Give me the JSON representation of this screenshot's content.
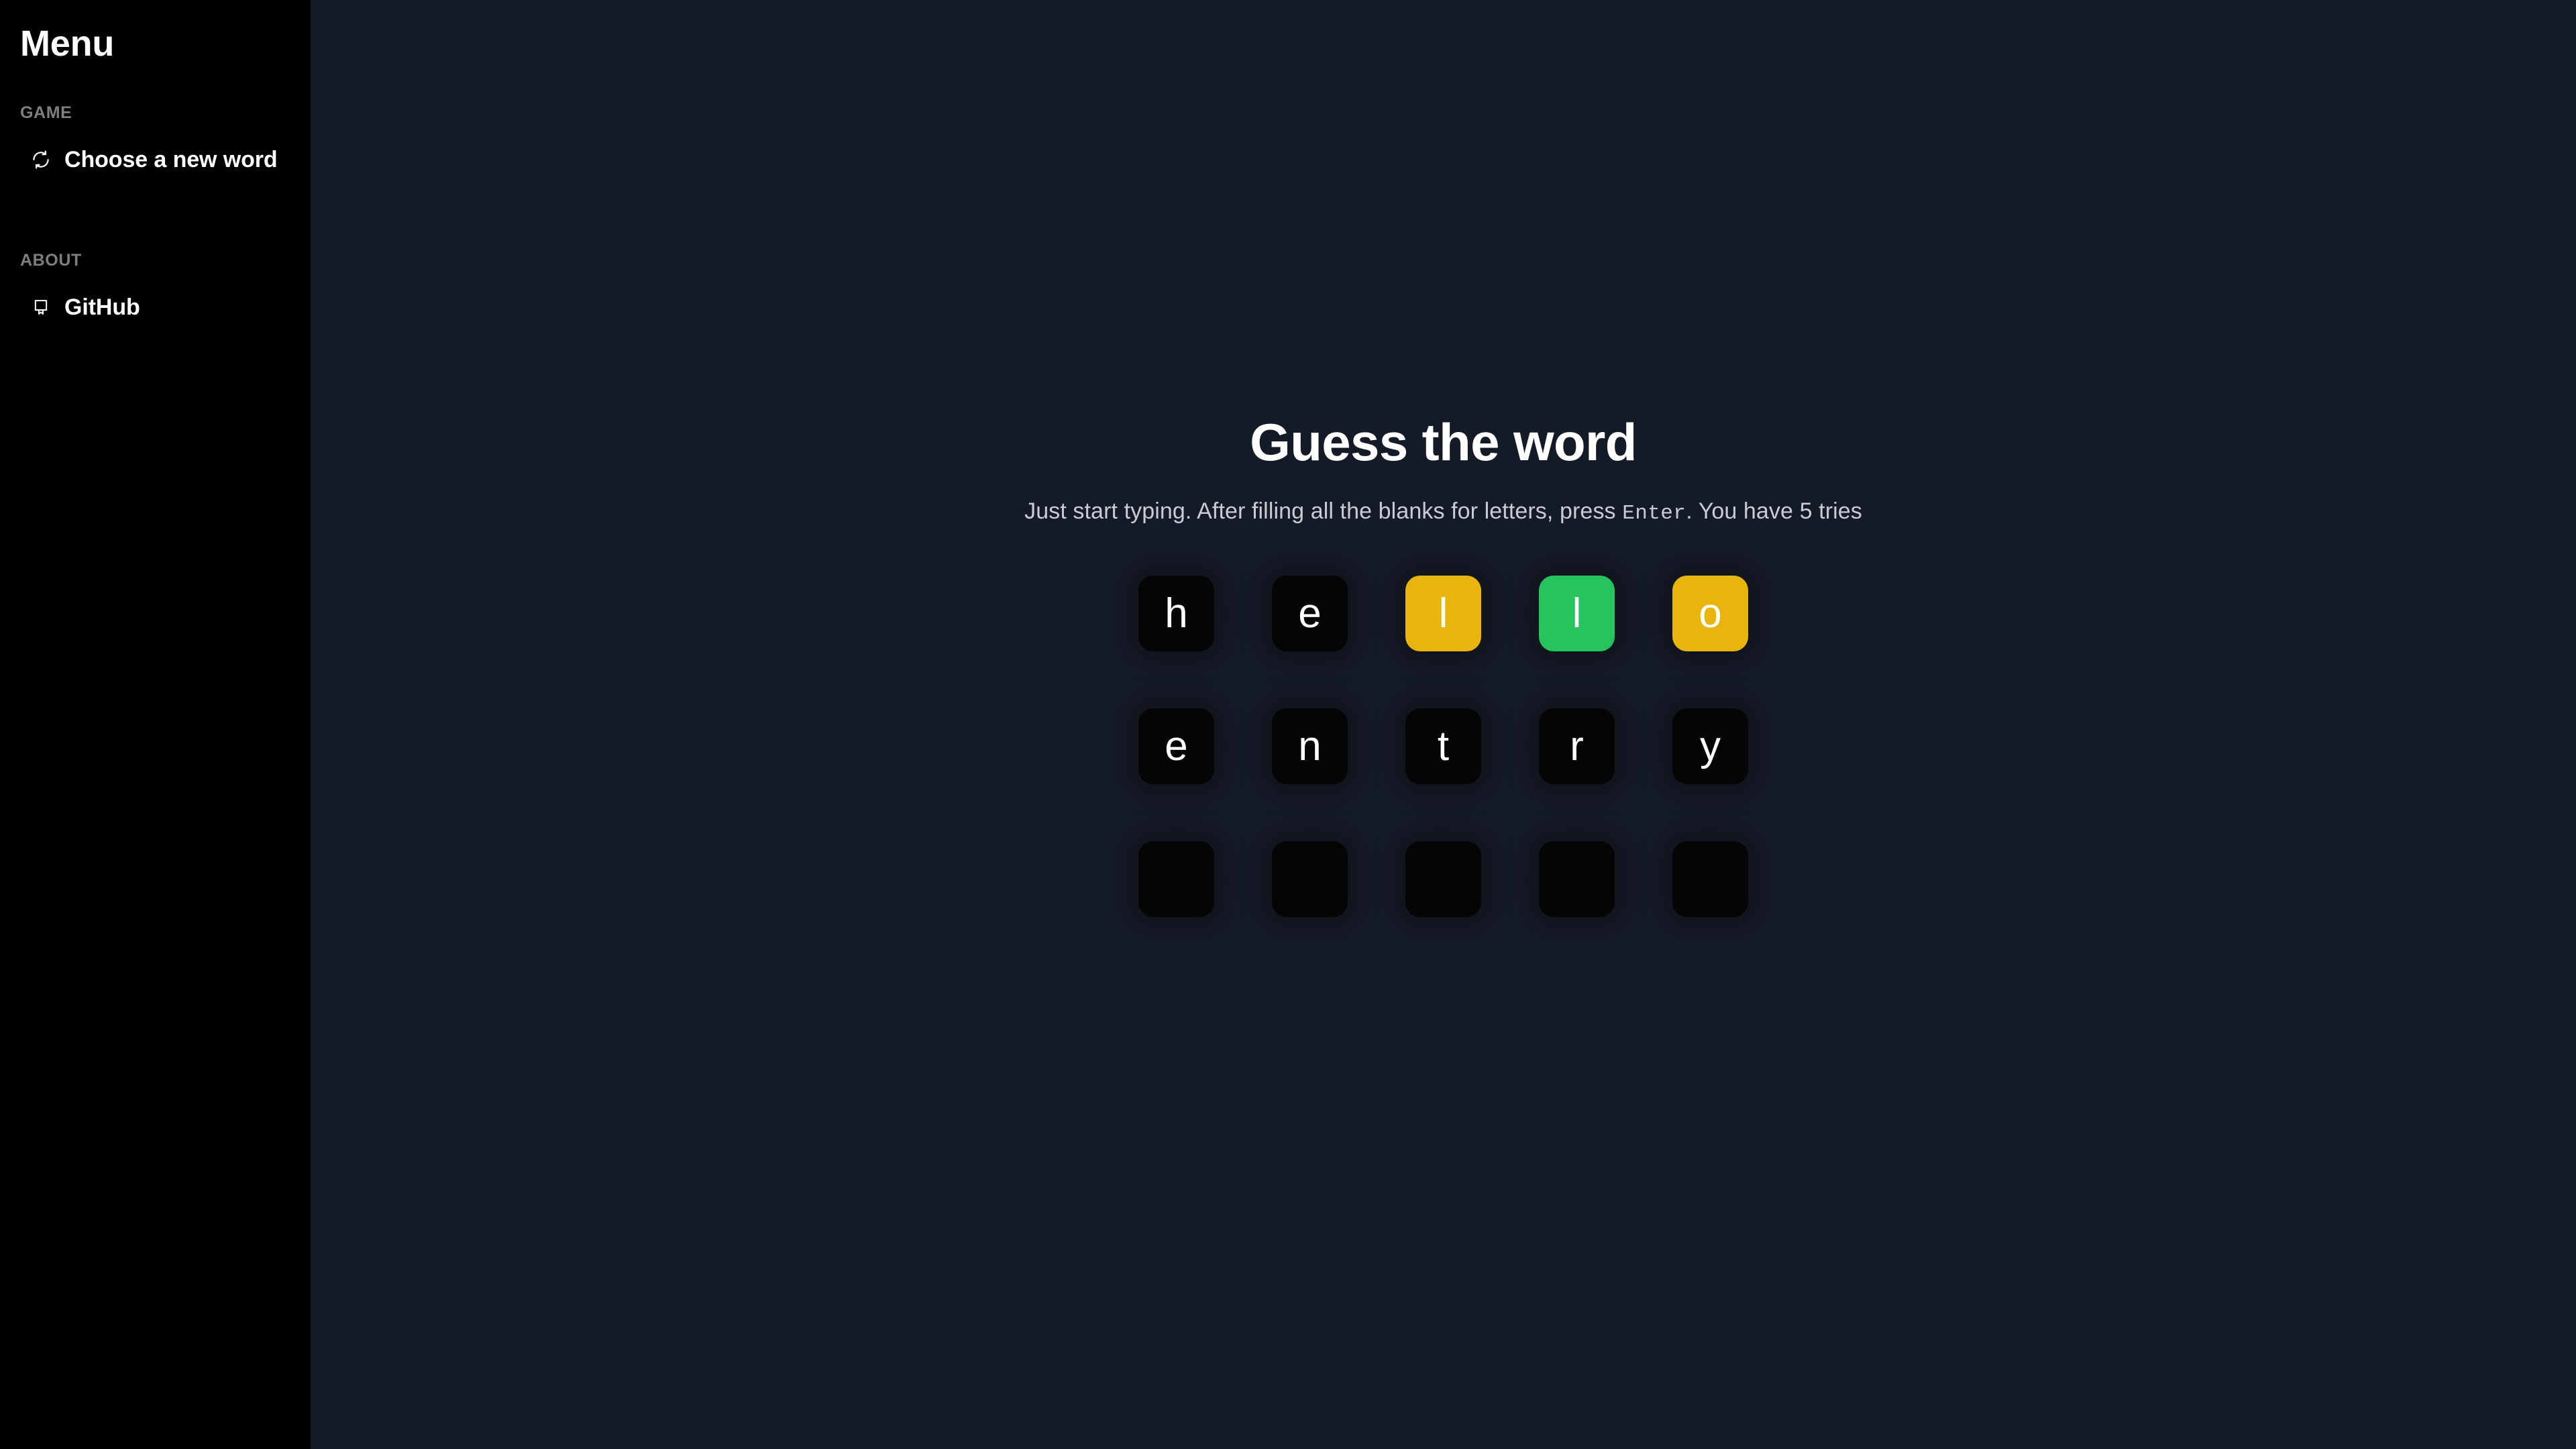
{
  "sidebar": {
    "title": "Menu",
    "sections": [
      {
        "label": "GAME",
        "items": [
          {
            "icon": "refresh-icon",
            "label": "Choose a new word",
            "name": "choose-a-new-word"
          }
        ]
      },
      {
        "label": "ABOUT",
        "items": [
          {
            "icon": "book-icon",
            "label": "GitHub",
            "name": "github"
          }
        ]
      }
    ]
  },
  "main": {
    "title": "Guess the word",
    "subtitle_before": "Just start typing. After filling all the blanks for letters, press ",
    "subtitle_key": "Enter",
    "subtitle_after": ". You have 5 tries",
    "tries": 5
  },
  "colors": {
    "background": "#151a27",
    "sidebar": "#000000",
    "tile_absent": "#050505",
    "tile_present": "#e8b50d",
    "tile_correct": "#25c45e",
    "text_primary": "#ffffff",
    "text_muted": "#c8ccd4",
    "section_label": "#7e7e7e"
  },
  "board": {
    "rows": [
      {
        "word": "hello",
        "tiles": [
          {
            "letter": "h",
            "state": "absent"
          },
          {
            "letter": "e",
            "state": "absent"
          },
          {
            "letter": "l",
            "state": "present"
          },
          {
            "letter": "l",
            "state": "correct"
          },
          {
            "letter": "o",
            "state": "present"
          }
        ]
      },
      {
        "word": "entry",
        "tiles": [
          {
            "letter": "e",
            "state": "absent"
          },
          {
            "letter": "n",
            "state": "absent"
          },
          {
            "letter": "t",
            "state": "absent"
          },
          {
            "letter": "r",
            "state": "absent"
          },
          {
            "letter": "y",
            "state": "absent"
          }
        ]
      },
      {
        "word": "",
        "tiles": [
          {
            "letter": "",
            "state": "empty"
          },
          {
            "letter": "",
            "state": "empty"
          },
          {
            "letter": "",
            "state": "empty"
          },
          {
            "letter": "",
            "state": "empty"
          },
          {
            "letter": "",
            "state": "empty"
          }
        ]
      }
    ]
  }
}
